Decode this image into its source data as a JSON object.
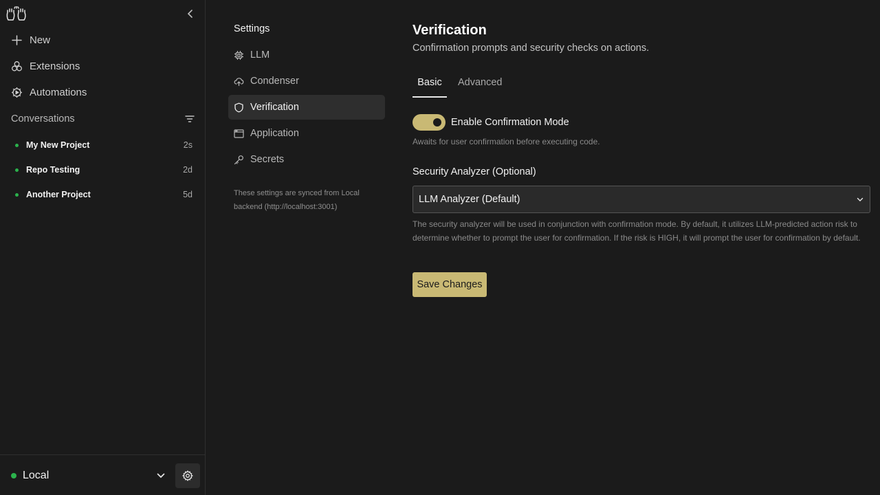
{
  "sidebar": {
    "logo_icon": "hands-logo-icon",
    "collapse_icon": "chevron-left-icon",
    "nav": {
      "new_label": "New",
      "extensions_label": "Extensions",
      "automations_label": "Automations"
    },
    "conversations_title": "Conversations",
    "conversations": [
      {
        "name": "My New Project",
        "time": "2s",
        "status": "active"
      },
      {
        "name": "Repo Testing",
        "time": "2d",
        "status": "active"
      },
      {
        "name": "Another Project",
        "time": "5d",
        "status": "active"
      }
    ],
    "backend_label": "Local",
    "status_color": "#2bb24c"
  },
  "settings_nav": {
    "title": "Settings",
    "items": [
      {
        "label": "LLM",
        "icon": "chip-icon"
      },
      {
        "label": "Condenser",
        "icon": "cloud-upload-icon"
      },
      {
        "label": "Verification",
        "icon": "shield-icon",
        "active": true
      },
      {
        "label": "Application",
        "icon": "browser-window-icon"
      },
      {
        "label": "Secrets",
        "icon": "key-icon"
      }
    ],
    "sync_note": "These settings are synced from Local backend (http://localhost:3001)"
  },
  "main": {
    "title": "Verification",
    "subtitle": "Confirmation prompts and security checks on actions.",
    "tabs": [
      "Basic",
      "Advanced"
    ],
    "active_tab": "Basic",
    "confirmation_toggle_label": "Enable Confirmation Mode",
    "confirmation_enabled": true,
    "confirmation_help": "Awaits for user confirmation before executing code.",
    "analyzer_label": "Security Analyzer (Optional)",
    "analyzer_value": "LLM Analyzer (Default)",
    "analyzer_help": "The security analyzer will be used in conjunction with confirmation mode. By default, it utilizes LLM-predicted action risk to determine whether to prompt the user for confirmation. If the risk is HIGH, it will prompt the user for confirmation by default.",
    "save_label": "Save Changes",
    "accent_color": "#c9b974"
  }
}
